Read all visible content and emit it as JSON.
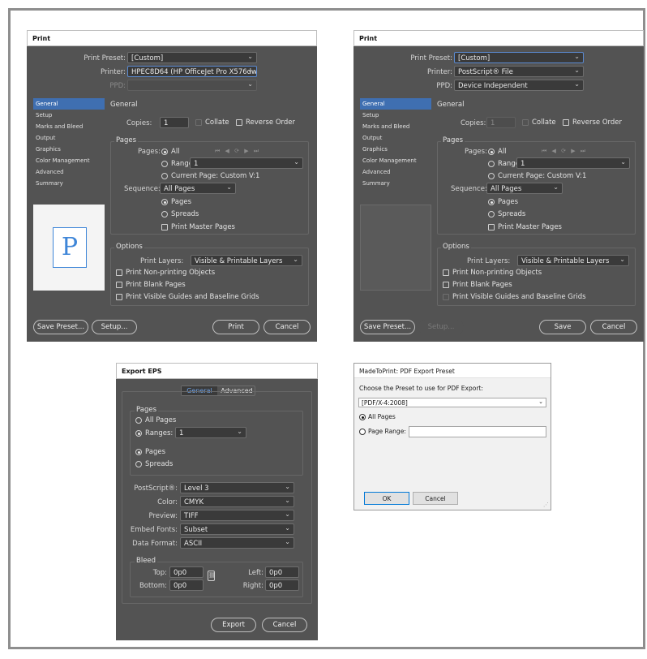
{
  "print1": {
    "title": "Print",
    "preset_label": "Print Preset:",
    "preset_value": "[Custom]",
    "printer_label": "Printer:",
    "printer_value": "HPEC8D64 (HP OfficeJet Pro X576dw ...",
    "ppd_label": "PPD:",
    "nav": [
      "General",
      "Setup",
      "Marks and Bleed",
      "Output",
      "Graphics",
      "Color Management",
      "Advanced",
      "Summary"
    ],
    "section_title": "General",
    "copies_label": "Copies:",
    "copies_value": "1",
    "collate_label": "Collate",
    "reverse_label": "Reverse Order",
    "pages_group": "Pages",
    "pages_label": "Pages:",
    "all_label": "All",
    "range_label": "Range:",
    "range_value": "1",
    "current_page_label": "Current Page: Custom V:1",
    "sequence_label": "Sequence:",
    "sequence_value": "All Pages",
    "pages_opt": "Pages",
    "spreads_opt": "Spreads",
    "master_label": "Print Master Pages",
    "options_group": "Options",
    "layers_label": "Print Layers:",
    "layers_value": "Visible & Printable Layers",
    "nonprinting_label": "Print Non-printing Objects",
    "blank_label": "Print Blank Pages",
    "guides_label": "Print Visible Guides and Baseline Grids",
    "preview_letter": "P",
    "save_preset": "Save Preset...",
    "setup": "Setup...",
    "print_btn": "Print",
    "cancel_btn": "Cancel",
    "pagenav": "⏮ ◀ ⟳ ▶ ⏭"
  },
  "print2": {
    "title": "Print",
    "preset_label": "Print Preset:",
    "preset_value": "[Custom]",
    "printer_label": "Printer:",
    "printer_value": "PostScript® File",
    "ppd_label": "PPD:",
    "ppd_value": "Device Independent",
    "nav": [
      "General",
      "Setup",
      "Marks and Bleed",
      "Output",
      "Graphics",
      "Color Management",
      "Advanced",
      "Summary"
    ],
    "section_title": "General",
    "copies_label": "Copies:",
    "copies_value": "1",
    "collate_label": "Collate",
    "reverse_label": "Reverse Order",
    "pages_group": "Pages",
    "pages_label": "Pages:",
    "all_label": "All",
    "range_label": "Range:",
    "range_value": "1",
    "current_page_label": "Current Page: Custom V:1",
    "sequence_label": "Sequence:",
    "sequence_value": "All Pages",
    "pages_opt": "Pages",
    "spreads_opt": "Spreads",
    "master_label": "Print Master Pages",
    "options_group": "Options",
    "layers_label": "Print Layers:",
    "layers_value": "Visible & Printable Layers",
    "nonprinting_label": "Print Non-printing Objects",
    "blank_label": "Print Blank Pages",
    "guides_label": "Print Visible Guides and Baseline Grids",
    "save_preset": "Save Preset...",
    "setup": "Setup...",
    "save_btn": "Save",
    "cancel_btn": "Cancel",
    "pagenav": "⏮ ◀ ⟳ ▶ ⏭"
  },
  "eps": {
    "title": "Export EPS",
    "tab_general": "General",
    "tab_advanced": "Advanced",
    "pages_group": "Pages",
    "all_pages": "All Pages",
    "ranges_label": "Ranges:",
    "ranges_value": "1",
    "pages_opt": "Pages",
    "spreads_opt": "Spreads",
    "postscript_label": "PostScript®:",
    "postscript_value": "Level 3",
    "color_label": "Color:",
    "color_value": "CMYK",
    "preview_label": "Preview:",
    "preview_value": "TIFF",
    "embed_label": "Embed Fonts:",
    "embed_value": "Subset",
    "format_label": "Data Format:",
    "format_value": "ASCII",
    "bleed_group": "Bleed",
    "top_label": "Top:",
    "top_value": "0p0",
    "bottom_label": "Bottom:",
    "bottom_value": "0p0",
    "left_label": "Left:",
    "left_value": "0p0",
    "right_label": "Right:",
    "right_value": "0p0",
    "export_btn": "Export",
    "cancel_btn": "Cancel"
  },
  "mtp": {
    "title": "MadeToPrint: PDF Export Preset",
    "prompt": "Choose the Preset to use for PDF Export:",
    "preset_value": "[PDF/X-4:2008]",
    "all_pages": "All Pages",
    "page_range": "Page Range:",
    "ok_btn": "OK",
    "cancel_btn": "Cancel"
  }
}
